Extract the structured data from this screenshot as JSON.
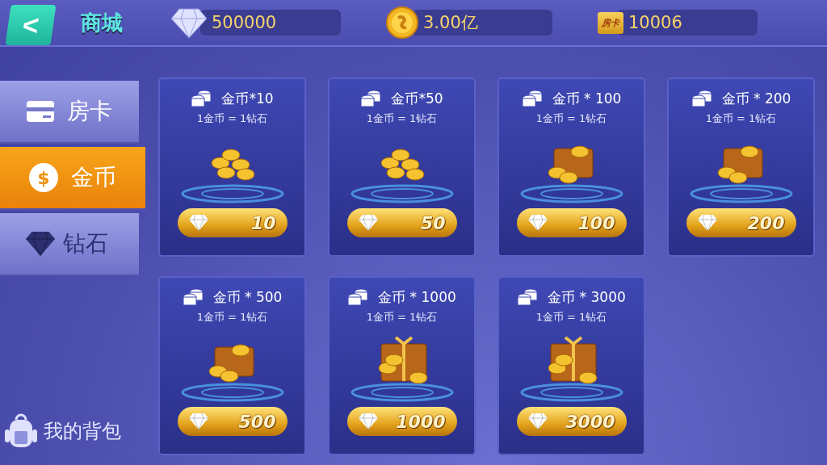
{
  "header": {
    "back": "<",
    "title": "商城"
  },
  "balances": [
    {
      "kind": "diamond",
      "value": "500000"
    },
    {
      "kind": "coin",
      "value": "3.00亿"
    },
    {
      "kind": "card",
      "icon_text": "房卡",
      "value": "10006"
    }
  ],
  "tabs": [
    {
      "kind": "card",
      "label": "房卡",
      "selected": false
    },
    {
      "kind": "coin",
      "icon_text": "$",
      "label": "金币",
      "selected": true
    },
    {
      "kind": "diamond",
      "label": "钻石",
      "selected": false
    }
  ],
  "backpack": {
    "label": "我的背包"
  },
  "products": [
    {
      "kind": "coins",
      "title": "金币*10",
      "rate": "1金币 = 1钻石",
      "price": "10"
    },
    {
      "kind": "coins",
      "title": "金币*50",
      "rate": "1金币 = 1钻石",
      "price": "50"
    },
    {
      "kind": "chest",
      "title": "金币 * 100",
      "rate": "1金币 = 1钻石",
      "price": "100"
    },
    {
      "kind": "chest",
      "title": "金币 * 200",
      "rate": "1金币 = 1钻石",
      "price": "200"
    },
    {
      "kind": "chest",
      "title": "金币 * 500",
      "rate": "1金币 = 1钻石",
      "price": "500"
    },
    {
      "kind": "gift",
      "title": "金币 * 1000",
      "rate": "1金币 = 1钻石",
      "price": "1000"
    },
    {
      "kind": "gift",
      "title": "金币 * 3000",
      "rate": "1金币 = 1钻石",
      "price": "3000"
    }
  ]
}
